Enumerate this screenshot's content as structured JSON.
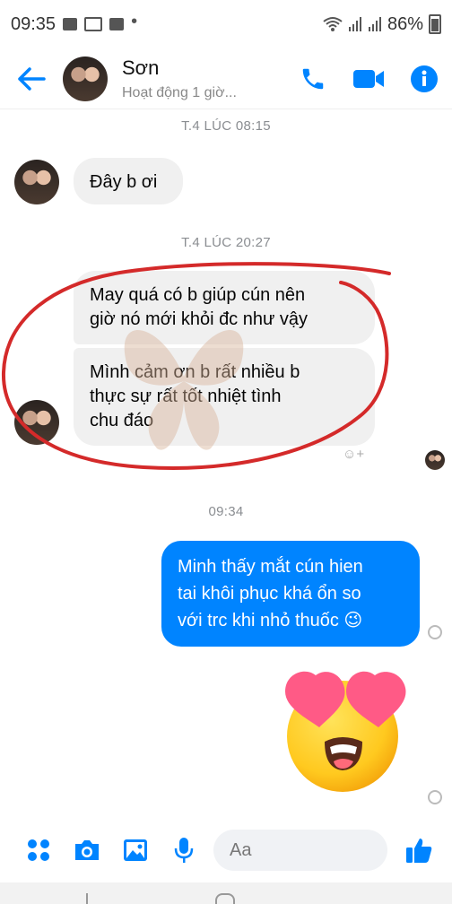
{
  "status_bar": {
    "time": "09:35",
    "battery": "86%"
  },
  "header": {
    "contact_name": "Sơn",
    "status": "Hoạt động 1 giờ..."
  },
  "chat": {
    "timestamp_1": "T.4 LÚC 08:15",
    "msg_1": "Đây b ơi",
    "timestamp_2": "T.4 LÚC 20:27",
    "msg_2_line1": "May quá có b giúp cún nên",
    "msg_2_line2": "giờ nó mới khỏi đc như vậy",
    "msg_3_line1": "Mình cảm ơn b rất nhiều b",
    "msg_3_line2": "thực sự rất tốt nhiệt tình",
    "msg_3_line3": "chu đáo",
    "react_label": "☺+",
    "timestamp_3": "09:34",
    "out_msg_line1": "Minh thấy mắt cún hien",
    "out_msg_line2": "tai khôi phục khá ổn so",
    "out_msg_line3": "với trc khi nhỏ thuốc 😉"
  },
  "composer": {
    "placeholder": "Aa"
  },
  "colors": {
    "accent": "#0084ff",
    "incoming_bubble": "#f0f0f0",
    "red_annotation": "#d42a2a"
  },
  "icons": [
    "back-arrow-icon",
    "phone-icon",
    "video-camera-icon",
    "info-icon",
    "apps-icon",
    "camera-icon",
    "image-icon",
    "microphone-icon",
    "emoji-icon",
    "thumbs-up-icon",
    "heart-eyes-emoji-icon",
    "seen-check-icon"
  ]
}
